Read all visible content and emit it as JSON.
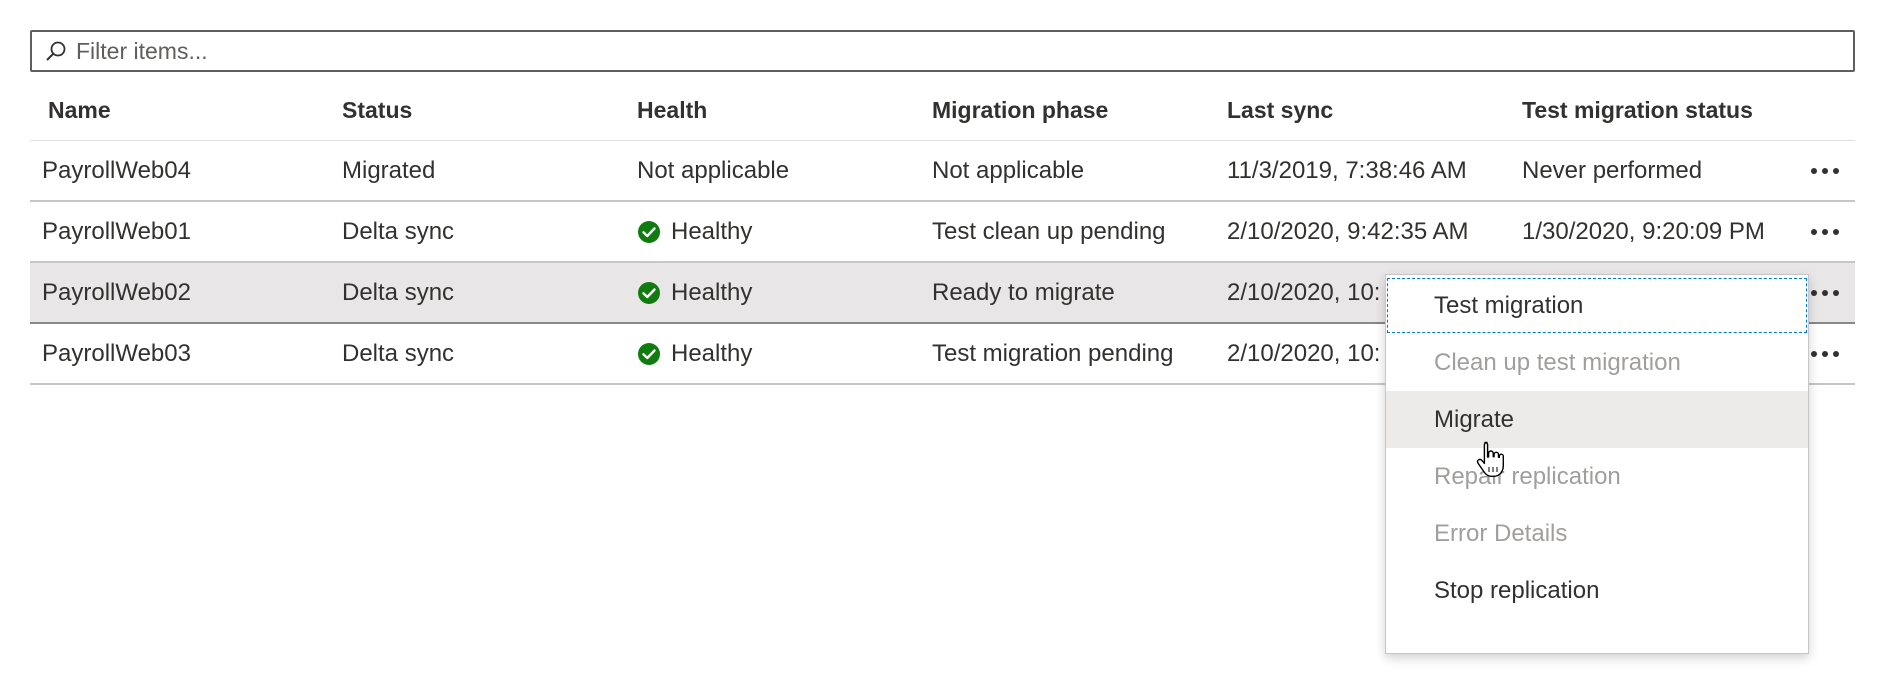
{
  "filter": {
    "placeholder": "Filter items...",
    "icon": "search-icon"
  },
  "table": {
    "columns": [
      "Name",
      "Status",
      "Health",
      "Migration phase",
      "Last sync",
      "Test migration status"
    ],
    "rows": [
      {
        "name": "PayrollWeb04",
        "status": "Migrated",
        "health": "Not applicable",
        "health_icon": "",
        "phase": "Not applicable",
        "last_sync": "11/3/2019, 7:38:46 AM",
        "test_status": "Never performed"
      },
      {
        "name": "PayrollWeb01",
        "status": "Delta sync",
        "health": "Healthy",
        "health_icon": "check-circle-icon",
        "phase": "Test clean up pending",
        "last_sync": "2/10/2020, 9:42:35 AM",
        "test_status": "1/30/2020, 9:20:09 PM"
      },
      {
        "name": "PayrollWeb02",
        "status": "Delta sync",
        "health": "Healthy",
        "health_icon": "check-circle-icon",
        "phase": "Ready to migrate",
        "last_sync": "2/10/2020, 10:",
        "test_status": "",
        "selected": true
      },
      {
        "name": "PayrollWeb03",
        "status": "Delta sync",
        "health": "Healthy",
        "health_icon": "check-circle-icon",
        "phase": "Test migration pending",
        "last_sync": "2/10/2020, 10:",
        "test_status": ""
      }
    ]
  },
  "context_menu": {
    "items": [
      {
        "label": "Test migration",
        "disabled": false
      },
      {
        "label": "Clean up test migration",
        "disabled": true
      },
      {
        "label": "Migrate",
        "disabled": false
      },
      {
        "label": "Repair replication",
        "disabled": true
      },
      {
        "label": "Error Details",
        "disabled": true
      },
      {
        "label": "Stop replication",
        "disabled": false
      }
    ]
  },
  "colors": {
    "healthy": "#107c10",
    "disabled_text": "#a19f9d",
    "focus_outline": "#0078d4",
    "selected_row": "#e8e6e6"
  }
}
